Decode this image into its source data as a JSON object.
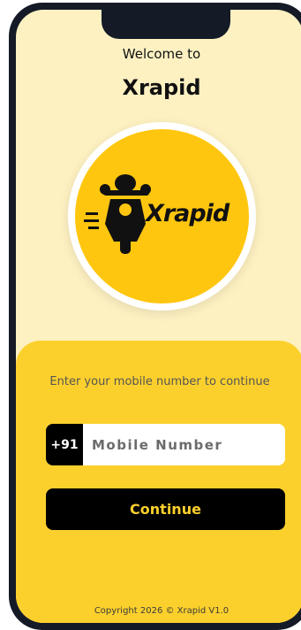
{
  "header": {
    "welcome": "Welcome to",
    "title": "Xrapid"
  },
  "logo": {
    "text": "Xrapid",
    "icon": "scooter-rider-icon",
    "background": "#ffc60f"
  },
  "login": {
    "prompt": "Enter your mobile number to continue",
    "country_code": "+91",
    "mobile_placeholder": "Mobile Number",
    "mobile_value": "",
    "continue_label": "Continue"
  },
  "footer": {
    "copyright": "Copyright 2026 © Xrapid V1.0"
  },
  "colors": {
    "accent": "#fcd02c",
    "background": "#fdf1c2",
    "dark": "#000000"
  }
}
